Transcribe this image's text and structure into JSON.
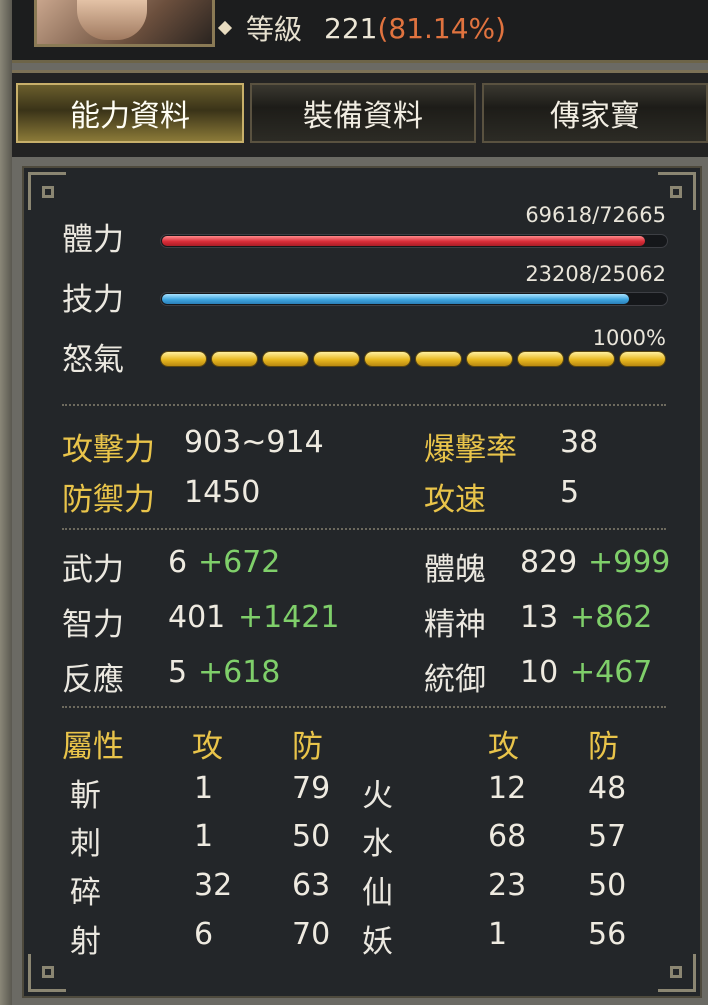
{
  "header": {
    "level_label": "等級",
    "level_value": "221",
    "level_pct": "(81.14%)"
  },
  "tabs": [
    {
      "label": "能力資料",
      "active": true
    },
    {
      "label": "裝備資料",
      "active": false
    },
    {
      "label": "傳家寶",
      "active": false
    }
  ],
  "bars": {
    "hp": {
      "label": "體力",
      "text": "69618/72665",
      "current": 69618,
      "max": 72665,
      "color": "#d82c38"
    },
    "mp": {
      "label": "技力",
      "text": "23208/25062",
      "current": 23208,
      "max": 25062,
      "color": "#3fa6e0"
    },
    "rage": {
      "label": "怒氣",
      "text": "1000%",
      "segments": 10,
      "color": "#e8b820"
    }
  },
  "combat": {
    "attack_label": "攻擊力",
    "attack_value": "903~914",
    "crit_label": "爆擊率",
    "crit_value": "38",
    "defense_label": "防禦力",
    "defense_value": "1450",
    "speed_label": "攻速",
    "speed_value": "5"
  },
  "attributes": [
    {
      "label": "武力",
      "base": "6",
      "bonus": "+672"
    },
    {
      "label": "體魄",
      "base": "829",
      "bonus": "+999"
    },
    {
      "label": "智力",
      "base": "401",
      "bonus": "+1421"
    },
    {
      "label": "精神",
      "base": "13",
      "bonus": "+862"
    },
    {
      "label": "反應",
      "base": "5",
      "bonus": "+618"
    },
    {
      "label": "統御",
      "base": "10",
      "bonus": "+467"
    }
  ],
  "elements": {
    "header_attr": "屬性",
    "header_atk": "攻",
    "header_def": "防",
    "rows": [
      {
        "l_name": "斬",
        "l_atk": "1",
        "l_def": "79",
        "r_name": "火",
        "r_atk": "12",
        "r_def": "48"
      },
      {
        "l_name": "刺",
        "l_atk": "1",
        "l_def": "50",
        "r_name": "水",
        "r_atk": "68",
        "r_def": "57"
      },
      {
        "l_name": "碎",
        "l_atk": "32",
        "l_def": "63",
        "r_name": "仙",
        "r_atk": "23",
        "r_def": "50"
      },
      {
        "l_name": "射",
        "l_atk": "6",
        "l_def": "70",
        "r_name": "妖",
        "r_atk": "1",
        "r_def": "56"
      }
    ]
  }
}
